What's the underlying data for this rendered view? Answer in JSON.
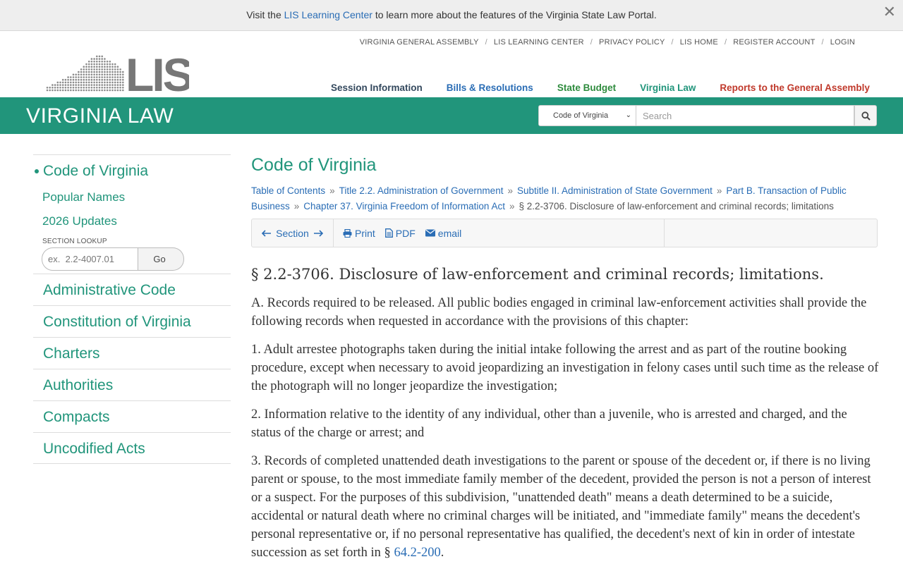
{
  "notice": {
    "prefix": "Visit the ",
    "link": "LIS Learning Center",
    "suffix": " to learn more about the features of the Virginia State Law Portal.",
    "close": "✕"
  },
  "header": {
    "utility_nav": [
      "VIRGINIA GENERAL ASSEMBLY",
      "LIS LEARNING CENTER",
      "PRIVACY POLICY",
      "LIS HOME",
      "REGISTER ACCOUNT",
      "LOGIN"
    ],
    "main_nav": [
      {
        "label": "Session Information",
        "color": "#34495e"
      },
      {
        "label": "Bills & Resolutions",
        "color": "#2a6db5"
      },
      {
        "label": "State Budget",
        "color": "#2e8b3d"
      },
      {
        "label": "Virginia Law",
        "color": "#21957b"
      },
      {
        "label": "Reports to the General Assembly",
        "color": "#c0392b"
      }
    ],
    "logo_text": "LIS"
  },
  "greenbar": {
    "title": "VIRGINIA LAW",
    "search_scope": "Code of Virginia",
    "search_placeholder": "Search"
  },
  "sidebar": {
    "active": "Code of Virginia",
    "sub": [
      "Popular Names",
      "2026 Updates"
    ],
    "lookup_label": "SECTION LOOKUP",
    "lookup_placeholder": "ex.  2.2-4007.01",
    "go": "Go",
    "items": [
      "Administrative Code",
      "Constitution of Virginia",
      "Charters",
      "Authorities",
      "Compacts",
      "Uncodified Acts"
    ]
  },
  "main": {
    "title": "Code of Virginia",
    "breadcrumbs": [
      "Table of Contents",
      "Title 2.2. Administration of Government",
      "Subtitle II. Administration of State Government",
      "Part B. Transaction of Public Business",
      "Chapter 37. Virginia Freedom of Information Act"
    ],
    "breadcrumb_current": "§ 2.2-3706. Disclosure of law-enforcement and criminal records; limitations",
    "toolbar": {
      "section": "Section",
      "print": "Print",
      "pdf": "PDF",
      "email": "email"
    },
    "section_heading": "§ 2.2-3706. Disclosure of law-enforcement and criminal records; limitations.",
    "paragraphs": [
      "A. Records required to be released. All public bodies engaged in criminal law-enforcement activities shall provide the following records when requested in accordance with the provisions of this chapter:",
      "1. Adult arrestee photographs taken during the initial intake following the arrest and as part of the routine booking procedure, except when necessary to avoid jeopardizing an investigation in felony cases until such time as the release of the photograph will no longer jeopardize the investigation;",
      "2. Information relative to the identity of any individual, other than a juvenile, who is arrested and charged, and the status of the charge or arrest; and"
    ],
    "last_paragraph": "3. Records of completed unattended death investigations to the parent or spouse of the decedent or, if there is no living parent or spouse, to the most immediate family member of the decedent, provided the person is not a person of interest or a suspect. For the purposes of this subdivision, \"unattended death\" means a death determined to be a suicide, accidental or natural death where no criminal charges will be initiated, and \"immediate family\" means the decedent's personal representative or, if no personal representative has qualified, the decedent's next of kin in order of intestate succession as set forth in § ",
    "last_link": "64.2-200",
    "last_end": "."
  },
  "colors": {
    "green": "#21957b",
    "link": "#2a6db5"
  }
}
